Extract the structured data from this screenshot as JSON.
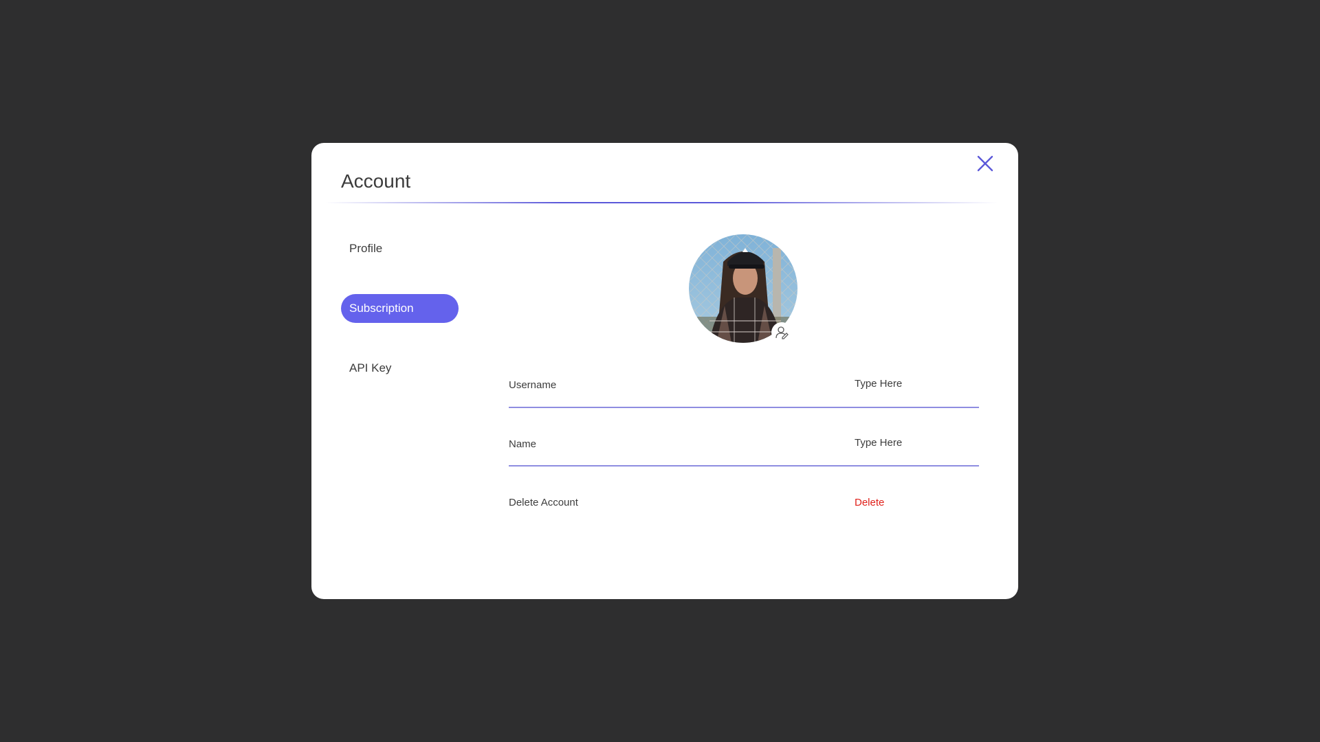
{
  "modal": {
    "title": "Account",
    "close_icon": "close-icon"
  },
  "sidebar": {
    "items": [
      {
        "label": "Profile",
        "active": false
      },
      {
        "label": "Subscription",
        "active": true
      },
      {
        "label": "API Key",
        "active": false
      }
    ]
  },
  "profile": {
    "avatar_icon": "avatar",
    "badge_icon": "user-edit-icon",
    "fields": [
      {
        "label": "Username",
        "placeholder": "Type Here",
        "value": ""
      },
      {
        "label": "Name",
        "placeholder": "Type Here",
        "value": ""
      }
    ],
    "delete": {
      "label": "Delete Account",
      "action_label": "Delete"
    }
  },
  "colors": {
    "accent": "#6462ec",
    "danger": "#e0201a",
    "background": "#2e2e2f",
    "panel": "#ffffff"
  }
}
